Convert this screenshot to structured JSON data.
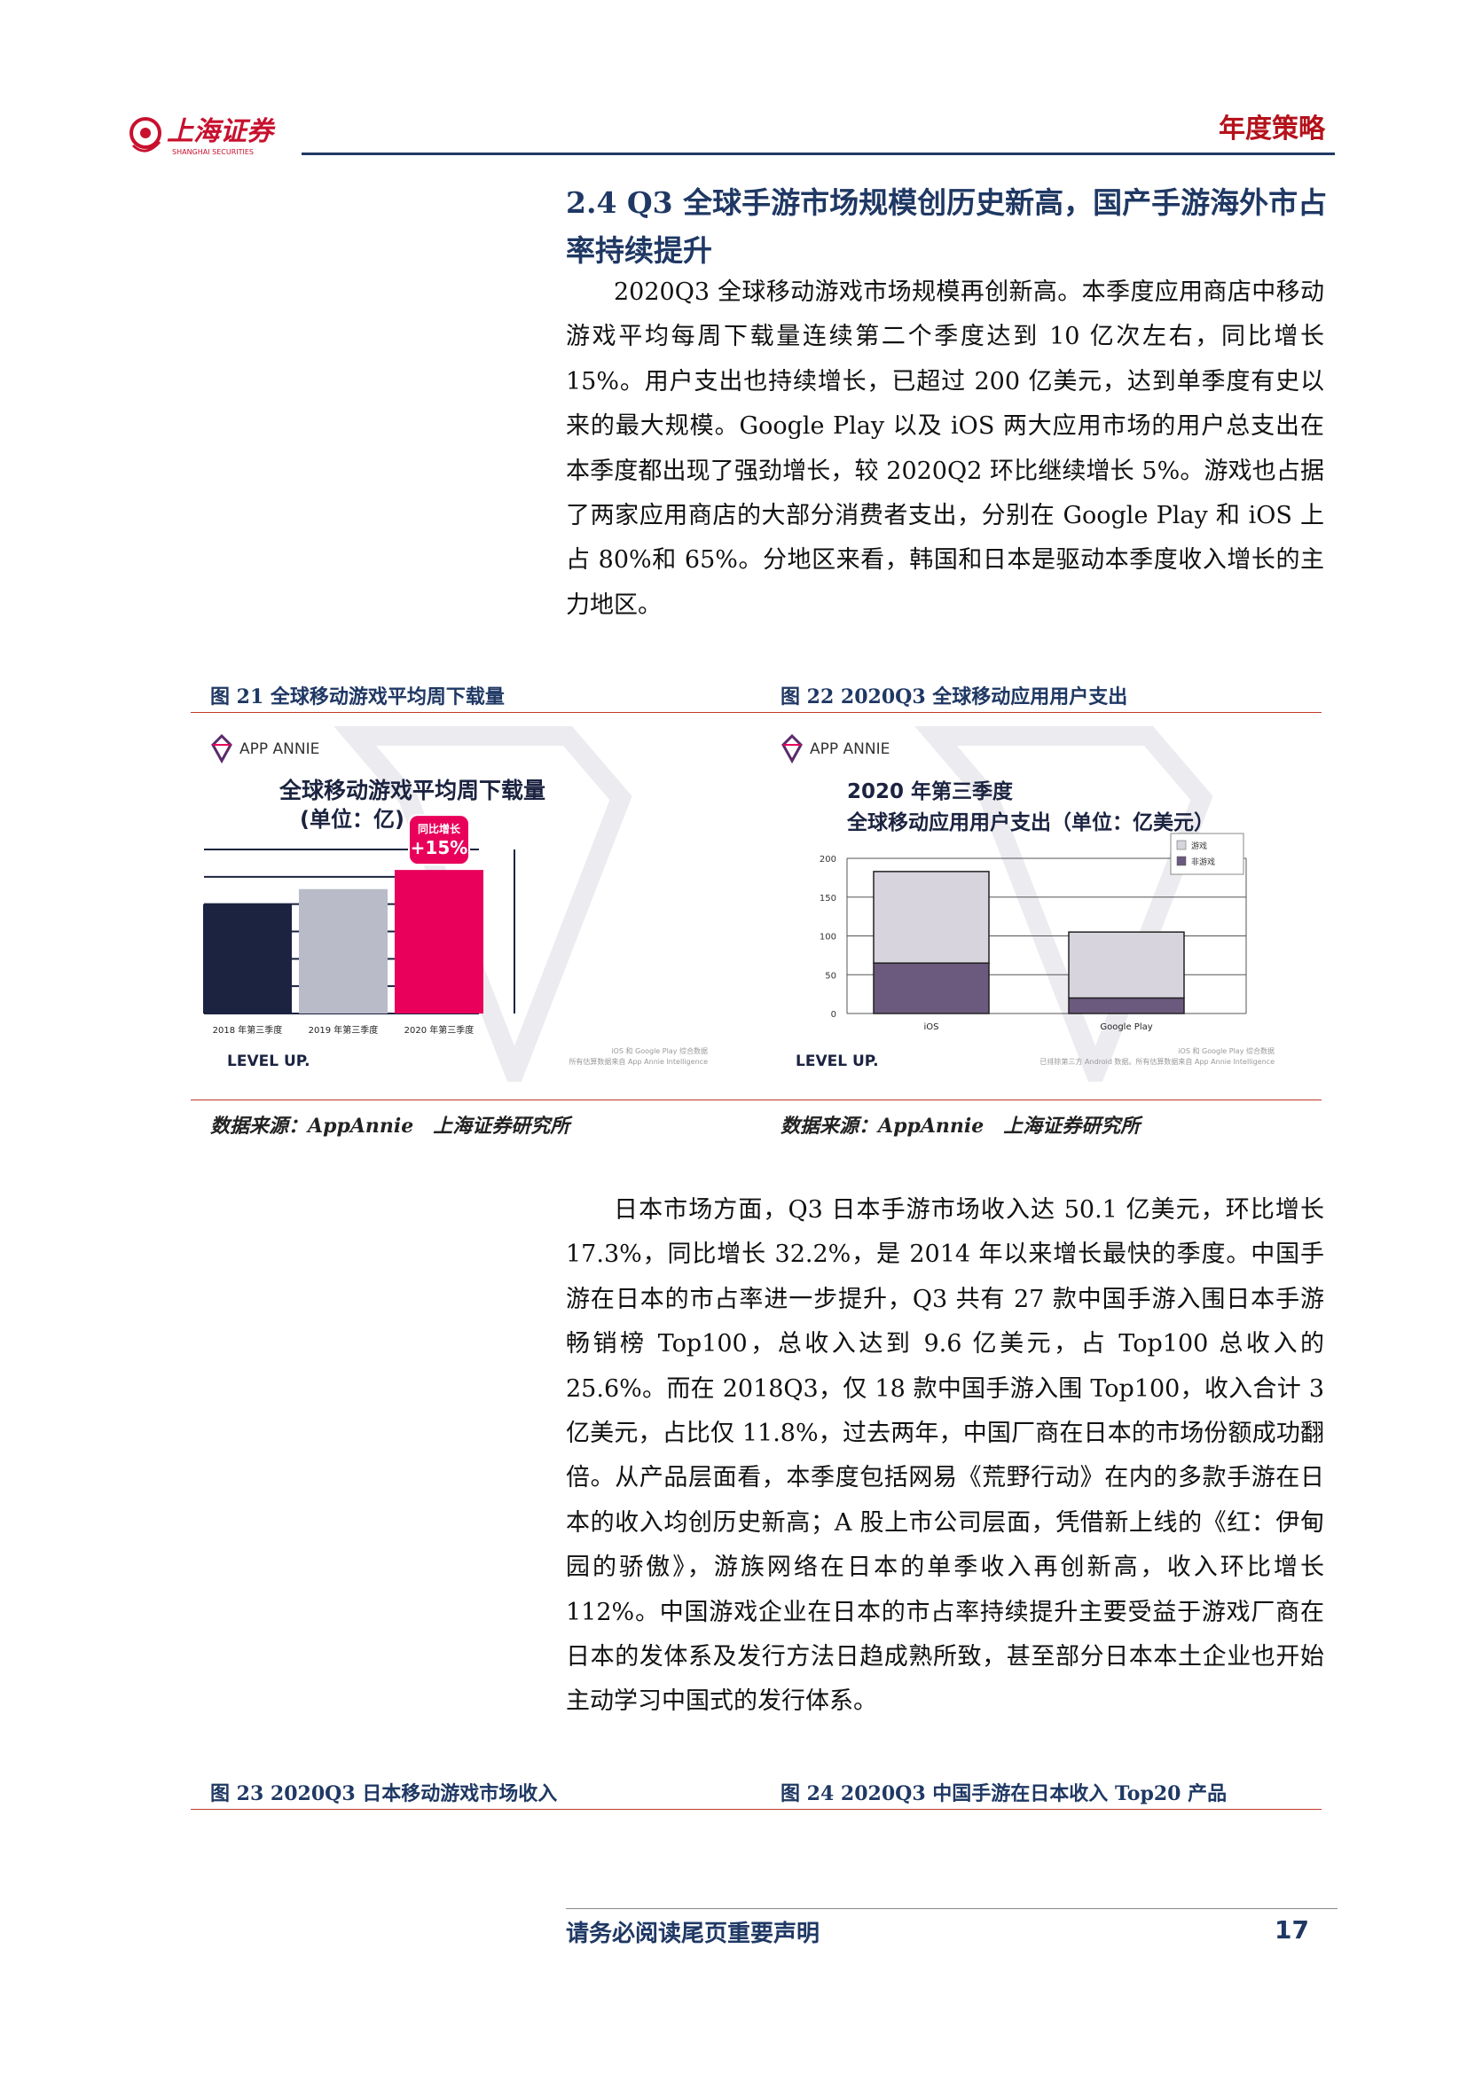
{
  "header": {
    "logo_text": "上海证券",
    "logo_sub": "SHANGHAI SECURITIES",
    "category": "年度策略"
  },
  "section": {
    "title": "2.4 Q3 全球手游市场规模创历史新高，国产手游海外市占率持续提升",
    "para1": "2020Q3 全球移动游戏市场规模再创新高。本季度应用商店中移动游戏平均每周下载量连续第二个季度达到 10 亿次左右，同比增长 15%。用户支出也持续增长，已超过 200 亿美元，达到单季度有史以来的最大规模。Google Play 以及 iOS 两大应用市场的用户总支出在本季度都出现了强劲增长，较 2020Q2 环比继续增长 5%。游戏也占据了两家应用商店的大部分消费者支出，分别在 Google Play 和 iOS 上占 80%和 65%。分地区来看，韩国和日本是驱动本季度收入增长的主力地区。",
    "para2": "日本市场方面，Q3 日本手游市场收入达 50.1 亿美元，环比增长 17.3%，同比增长 32.2%，是 2014 年以来增长最快的季度。中国手游在日本的市占率进一步提升，Q3 共有 27 款中国手游入围日本手游畅销榜 Top100，总收入达到 9.6 亿美元，占 Top100 总收入的 25.6%。而在 2018Q3，仅 18 款中国手游入围 Top100，收入合计 3 亿美元，占比仅 11.8%，过去两年，中国厂商在日本的市场份额成功翻倍。从产品层面看，本季度包括网易《荒野行动》在内的多款手游在日本的收入均创历史新高；A 股上市公司层面，凭借新上线的《红：伊甸园的骄傲》，游族网络在日本的单季收入再创新高，收入环比增长 112%。中国游戏企业在日本的市占率持续提升主要受益于游戏厂商在日本的发体系及发行方法日趋成熟所致，甚至部分日本本土企业也开始主动学习中国式的发行体系。"
  },
  "figures": {
    "fig21_caption": "图 21 全球移动游戏平均周下载量",
    "fig22_caption": "图 22 2020Q3 全球移动应用用户支出",
    "fig23_caption": "图 23 2020Q3 日本移动游戏市场收入",
    "fig24_caption": "图 24 2020Q3 中国手游在日本收入 Top20 产品",
    "source": "数据来源：AppAnnie　上海证券研究所"
  },
  "chart_data": [
    {
      "type": "bar",
      "brand": "APP ANNIE",
      "title": "全球移动游戏平均周下载量",
      "subtitle": "(单位：亿)",
      "categories": [
        "2018 年第三季度",
        "2019 年第三季度",
        "2020 年第三季度"
      ],
      "values": [
        8.0,
        9.1,
        10.5
      ],
      "colors": [
        "#1b2340",
        "#b9bcc8",
        "#e8005a"
      ],
      "ylim": [
        0,
        12
      ],
      "yticks": [
        0,
        2,
        4,
        6,
        8,
        10,
        12
      ],
      "annotation": {
        "label": "同比增长",
        "value": "+15%"
      },
      "footnote_1": "iOS 和 Google Play 综合数据",
      "footnote_2": "所有估算数据来自 App Annie Intelligence",
      "tagline": "LEVEL UP."
    },
    {
      "type": "bar",
      "stacked": true,
      "brand": "APP ANNIE",
      "title": "2020 年第三季度",
      "subtitle": "全球移动应用用户支出（单位：亿美元）",
      "categories": [
        "iOS",
        "Google Play"
      ],
      "series": [
        {
          "name": "非游戏",
          "values": [
            65,
            20
          ],
          "color": "#6b5a7e"
        },
        {
          "name": "游戏",
          "values": [
            118,
            85
          ],
          "color": "#d8d4de"
        }
      ],
      "ylim": [
        0,
        200
      ],
      "yticks": [
        0,
        50,
        100,
        150,
        200
      ],
      "footnote_1": "iOS 和 Google Play 综合数据",
      "footnote_2": "已排除第三方 Android 数据。所有估算数据来自 App Annie Intelligence",
      "tagline": "LEVEL UP."
    }
  ],
  "footer": {
    "note": "请务必阅读尾页重要声明",
    "page": "17"
  }
}
